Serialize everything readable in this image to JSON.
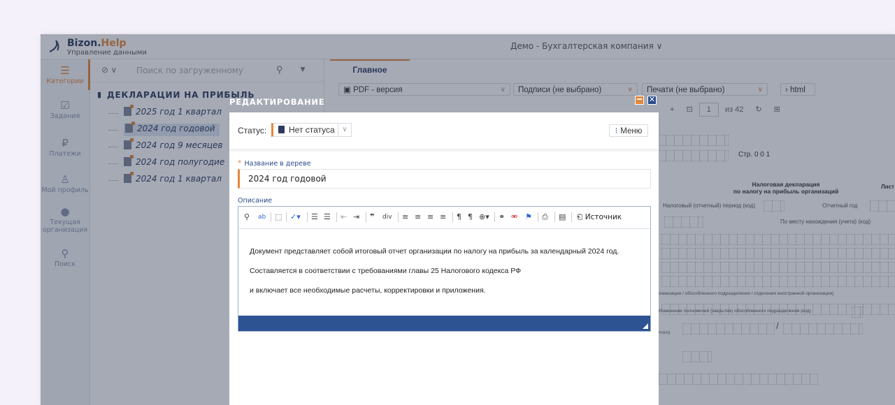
{
  "app": {
    "brand": "Bizon.",
    "brand_accent": "Help",
    "subtitle": "Управление данными",
    "company": "Демо - Бухгалтерская компания ∨"
  },
  "rail": {
    "items": [
      {
        "label": "Категории",
        "icon": "menu-icon"
      },
      {
        "label": "Задания",
        "icon": "tasks-icon"
      },
      {
        "label": "Платежи",
        "icon": "ruble-icon"
      },
      {
        "label": "Мой профиль",
        "icon": "user-icon"
      },
      {
        "label": "Текущая организация",
        "icon": "location-icon"
      },
      {
        "label": "Поиск",
        "icon": "search-icon"
      }
    ]
  },
  "tree": {
    "search_placeholder": "Поиск по загруженному",
    "title": "ДЕКЛАРАЦИИ НА ПРИБЫЛЬ",
    "nodes": [
      {
        "label": "2025 год 1 квартал"
      },
      {
        "label": "2024 год годовой"
      },
      {
        "label": "2024 год 9 месяцев"
      },
      {
        "label": "2024 год полугодие"
      },
      {
        "label": "2024 год 1 квартал"
      }
    ]
  },
  "document": {
    "tab": "Главное",
    "pdf": "PDF - версия",
    "signatures": "Подписи (не выбрано)",
    "prints": "Печати (не выбрано)",
    "html": "html",
    "page": "1",
    "page_total": "из 42",
    "page_label": "Стр.",
    "page_code": "0 0 1",
    "form_title": "Налоговая декларация",
    "form_subtitle": "по налогу на прибыль организаций",
    "sheet": "Лист",
    "period_label": "Налоговый (отчетный) период (код)",
    "year_label": "Отчетный год",
    "location_label": "По месту нахождения (учета) (код)",
    "org_label": "рганизации / обособленного подразделения / отделения иностранной организации)",
    "powers_label": "Изменение полномочий (закрытие) обособленного подразделения (код)",
    "other_label": "итого)",
    "slash": "/"
  },
  "modal": {
    "title": "РЕДАКТИРОВАНИЕ",
    "status_label": "Статус:",
    "status_value": "Нет статуса",
    "menu_label": "Меню",
    "name_label": "Название в дереве",
    "name_value": "2024 год годовой",
    "desc_label": "Описание",
    "source_label": "Источник",
    "desc_lines": [
      "Документ представляет собой итоговый отчет организации по налогу на прибыль за календарный 2024 год.",
      "Составляется в соответствии с требованиями главы 25 Налогового кодекса РФ",
      "и включает все необходимые расчеты, корректировки и приложения."
    ]
  },
  "colors": {
    "accent": "#e6873a",
    "primary": "#2d5393",
    "text": "#2e3a5c"
  }
}
